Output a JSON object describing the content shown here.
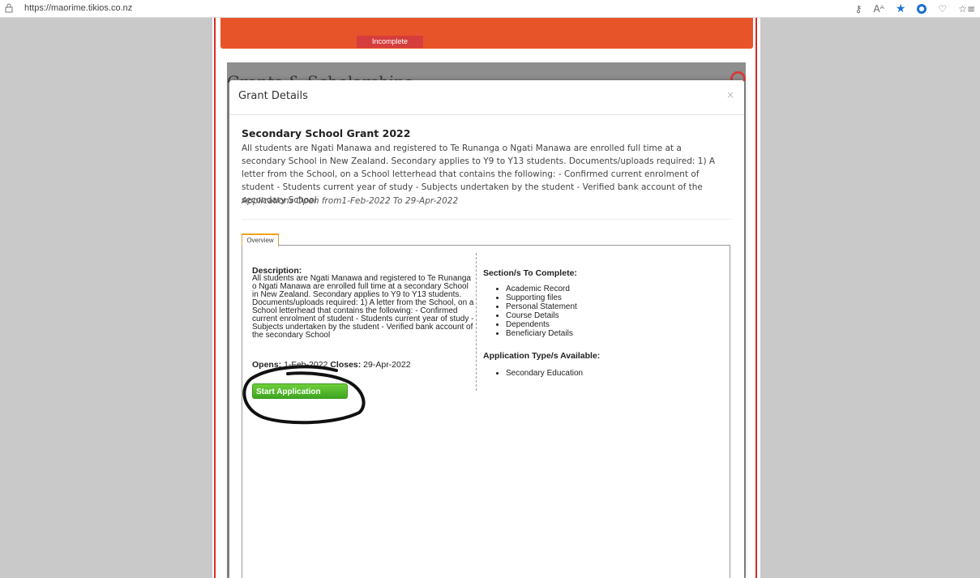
{
  "browser": {
    "url": "https://maorime.tikios.co.nz",
    "toolbar_icons": [
      "key-icon",
      "read-aloud-icon",
      "favorite-star-icon",
      "extension-icon",
      "browser-essentials-icon",
      "favorites-bar-icon"
    ]
  },
  "banner": {
    "status": "Incomplete",
    "color": "#e8542a"
  },
  "background": {
    "title": "Grants & Scholarships"
  },
  "modal": {
    "title": "Grant Details",
    "close": "×",
    "grant_title": "Secondary School Grant 2022",
    "grant_description": "All students are Ngati Manawa and registered to Te Runanga o Ngati Manawa are enrolled full time at a secondary School in New Zealand. Secondary applies to Y9 to Y13 students. Documents/uploads required: 1) A letter from the School, on a School letterhead that contains the following: - Confirmed current enrolment of student - Students current year of study - Subjects undertaken by the student - Verified bank account of the secondary School",
    "applications_open": "Applications Open from1-Feb-2022 To 29-Apr-2022",
    "tabs": [
      {
        "label": "Overview",
        "active": true
      }
    ],
    "overview": {
      "description_label": "Description:",
      "description_text": "All students are Ngati Manawa and registered to Te Runanga o Ngati Manawa are enrolled full time at a secondary School in New Zealand. Secondary applies to Y9 to Y13 students. Documents/uploads required: 1) A letter from the School, on a School letterhead that contains the following: - Confirmed current enrolment of student - Students current year of study - Subjects undertaken by the student - Verified bank account of the secondary School",
      "opens_label": "Opens:",
      "opens_value": "1-Feb-2022",
      "closes_label": "Closes:",
      "closes_value": "29-Apr-2022",
      "start_button": "Start Application",
      "sections_label": "Section/s To Complete:",
      "sections": [
        "Academic Record",
        "Supporting files",
        "Personal Statement",
        "Course Details",
        "Dependents",
        "Beneficiary Details"
      ],
      "app_types_label": "Application Type/s Available:",
      "app_types": [
        "Secondary Education"
      ]
    }
  },
  "colors": {
    "accent_green": "#4cb52a",
    "tab_orange": "#f0a21a",
    "status_red": "#d63d3d"
  }
}
